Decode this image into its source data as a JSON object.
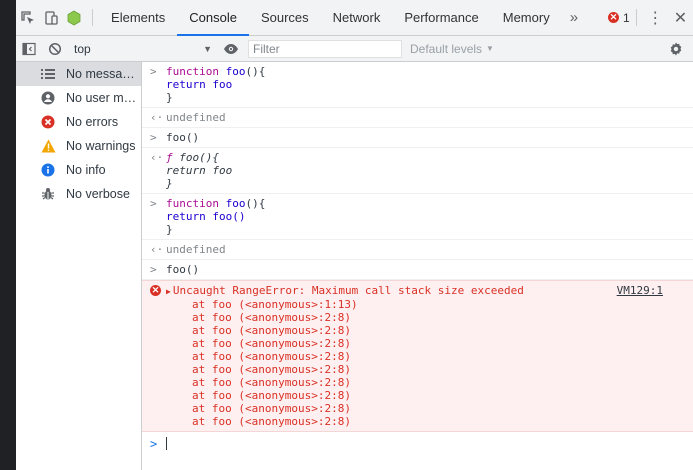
{
  "tabs": {
    "items": [
      "Elements",
      "Console",
      "Sources",
      "Network",
      "Performance",
      "Memory"
    ],
    "active": "Console",
    "more": "»",
    "error_count": "1"
  },
  "toolbar": {
    "context": "top",
    "filter_placeholder": "Filter",
    "levels": "Default levels"
  },
  "sidebar": {
    "items": [
      {
        "label": "No messages",
        "icon": "list-icon"
      },
      {
        "label": "No user me...",
        "icon": "user-icon"
      },
      {
        "label": "No errors",
        "icon": "error-icon"
      },
      {
        "label": "No warnings",
        "icon": "warning-icon"
      },
      {
        "label": "No info",
        "icon": "info-icon"
      },
      {
        "label": "No verbose",
        "icon": "bug-icon"
      }
    ]
  },
  "console": {
    "entry1": {
      "kw": "function",
      "name": "foo",
      "sig": "(){",
      "body": "return foo",
      "close": "}"
    },
    "result1": "undefined",
    "entry2": "foo()",
    "result2": {
      "f": "ƒ",
      "sig": "foo(){",
      "body": "return foo",
      "close": "}"
    },
    "entry3": {
      "kw": "function",
      "name": "foo",
      "sig": "(){",
      "body": "return foo()",
      "close": "}"
    },
    "result3": "undefined",
    "entry4": "foo()",
    "error": {
      "message": "Uncaught RangeError: Maximum call stack size exceeded",
      "source": "VM129:1",
      "stack": [
        "at foo (<anonymous>:1:13)",
        "at foo (<anonymous>:2:8)",
        "at foo (<anonymous>:2:8)",
        "at foo (<anonymous>:2:8)",
        "at foo (<anonymous>:2:8)",
        "at foo (<anonymous>:2:8)",
        "at foo (<anonymous>:2:8)",
        "at foo (<anonymous>:2:8)",
        "at foo (<anonymous>:2:8)",
        "at foo (<anonymous>:2:8)"
      ]
    }
  },
  "colors": {
    "accent": "#1a73e8",
    "error": "#d93025",
    "error_bg": "#fef0f0"
  }
}
